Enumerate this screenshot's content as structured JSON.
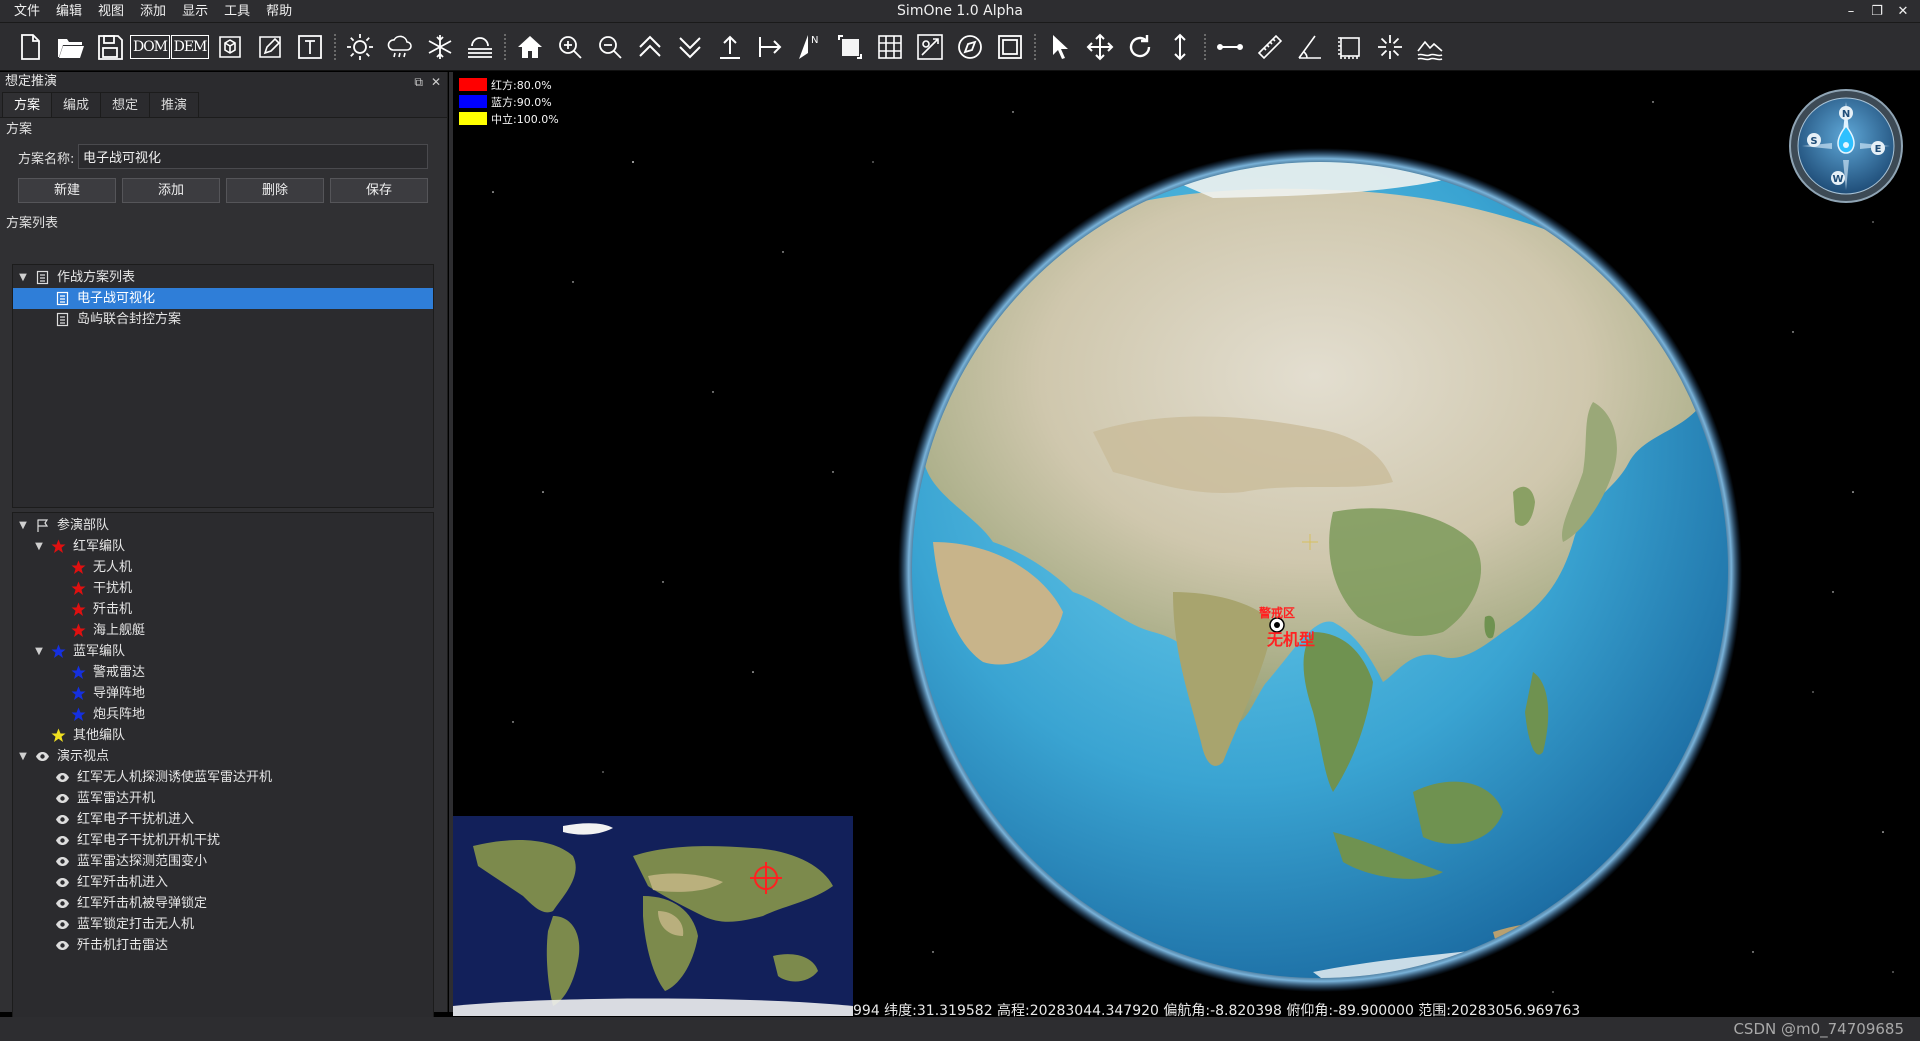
{
  "window": {
    "title": "SimOne 1.0 Alpha",
    "controls": [
      "–",
      "❐",
      "✕"
    ]
  },
  "menu": [
    "文件",
    "编辑",
    "视图",
    "添加",
    "显示",
    "工具",
    "帮助"
  ],
  "toolbar": {
    "icons": [
      "new-file-icon",
      "open-folder-icon",
      "save-icon",
      "dom-icon",
      "dem-icon",
      "cube-icon",
      "edit-icon",
      "text-icon",
      "sun-icon",
      "rain-icon",
      "snow-icon",
      "fog-icon",
      "home-icon",
      "zoom-in-icon",
      "zoom-out-icon",
      "up-icon",
      "down-icon",
      "upload-icon",
      "arrow-right-icon",
      "north-icon",
      "frame-icon",
      "grid-icon",
      "map-edit-icon",
      "compass-icon",
      "square-icon",
      "pointer-icon",
      "move-icon",
      "rotate-icon",
      "vertical-move-icon",
      "line-measure-icon",
      "ruler-icon",
      "angle-icon",
      "area-icon",
      "burst-icon",
      "terrain-icon"
    ],
    "dom_label": "DOM",
    "dem_label": "DEM"
  },
  "panel": {
    "title": "想定推演",
    "float_icon": "⧉",
    "close_icon": "✕",
    "tabs": [
      "方案",
      "编成",
      "想定",
      "推演"
    ],
    "section_scheme": "方案",
    "scheme_name_label": "方案名称:",
    "scheme_name_value": "电子战可视化",
    "buttons": [
      "新建",
      "添加",
      "删除",
      "保存"
    ],
    "section_list": "方案列表",
    "scheme_tree": {
      "root": "作战方案列表",
      "items": [
        "电子战可视化",
        "岛屿联合封控方案"
      ],
      "selected_index": 0
    },
    "forces_tree": {
      "root": "参演部队",
      "red_group": "红军编队",
      "red_units": [
        "无人机",
        "干扰机",
        "歼击机",
        "海上舰艇"
      ],
      "blue_group": "蓝军编队",
      "blue_units": [
        "警戒雷达",
        "导弹阵地",
        "炮兵阵地"
      ],
      "other_group": "其他编队",
      "views_root": "演示视点",
      "views": [
        "红军无人机探测诱使蓝军雷达开机",
        "蓝军雷达开机",
        "红军电子干扰机进入",
        "红军电子干扰机开机干扰",
        "蓝军雷达探测范围变小",
        "红军歼击机进入",
        "红军歼击机被导弹锁定",
        "蓝军锁定打击无人机",
        "歼击机打击雷达"
      ]
    }
  },
  "viewport": {
    "legend": [
      {
        "label": "红方:80.0%",
        "color": "#ff0000"
      },
      {
        "label": "蓝方:90.0%",
        "color": "#0000ff"
      },
      {
        "label": "中立:100.0%",
        "color": "#ffff00"
      }
    ],
    "target_title": "警戒区",
    "target_label": "无机型",
    "coordinates": "994  纬度:31.319582  高程:20283044.347920  偏航角:-8.820398  俯仰角:-89.900000  范围:20283056.969763",
    "compass": {
      "n": "N",
      "e": "E",
      "s": "S",
      "w": "W"
    }
  },
  "status": {
    "watermark": "CSDN @m0_74709685"
  }
}
